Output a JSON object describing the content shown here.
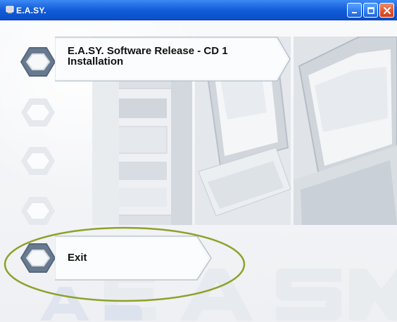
{
  "window": {
    "title": "E.A.SY."
  },
  "menu": [
    {
      "label": "E.A.SY. Software Release - CD 1\nInstallation",
      "active": true
    },
    {
      "label": "",
      "active": false
    },
    {
      "label": "",
      "active": false
    },
    {
      "label": "",
      "active": false
    },
    {
      "label": "Exit",
      "active": true
    }
  ],
  "colors": {
    "titlebar": "#0f5bd8",
    "menu_active_icon": "#6c7c91",
    "menu_inactive_icon": "#dfe3e8",
    "highlight": "#8ea12a"
  },
  "icons": [
    "app-icon",
    "minimize-icon",
    "maximize-icon",
    "close-icon",
    "hexagon-icon"
  ]
}
